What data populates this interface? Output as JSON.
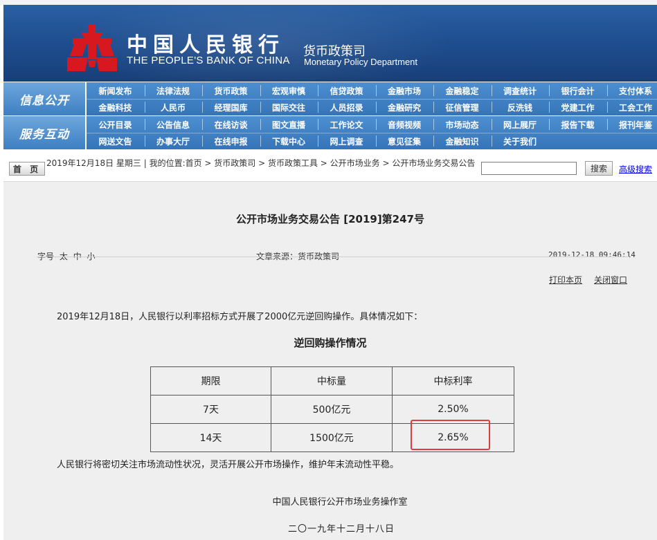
{
  "header": {
    "bank_name_cn": "中国人民银行",
    "bank_name_en": "THE PEOPLE'S BANK OF CHINA",
    "department_cn": "货币政策司",
    "department_en": "Monetary Policy Department",
    "brand_color": "#1f4f91",
    "emblem_color": "#d7191f"
  },
  "nav": {
    "groups": [
      {
        "title": "信息公开",
        "row1": [
          "新闻发布",
          "法律法规",
          "货币政策",
          "宏观审慎",
          "信贷政策",
          "金融市场",
          "金融稳定",
          "调查统计",
          "银行会计",
          "支付体系"
        ],
        "row2": [
          "金融科技",
          "人民币",
          "经理国库",
          "国际交往",
          "人员招录",
          "金融研究",
          "征信管理",
          "反洗钱",
          "党建工作",
          "工会工作"
        ]
      },
      {
        "title": "服务互动",
        "row1": [
          "公开目录",
          "公告信息",
          "在线访谈",
          "图文直播",
          "工作论文",
          "音频视频",
          "市场动态",
          "网上展厅",
          "报告下载",
          "报刊年鉴"
        ],
        "row2": [
          "网送文告",
          "办事大厅",
          "在线申报",
          "下载中心",
          "网上调查",
          "意见征集",
          "金融知识",
          "关于我们"
        ]
      }
    ]
  },
  "breadcrumb": {
    "home_label": "首 页",
    "text": "2019年12月18日 星期三 | 我的位置:首页 > 货币政策司 > 货币政策工具 > 公开市场业务 > 公开市场业务交易公告",
    "search_placeholder": "",
    "search_button": "搜索",
    "advanced_search": "高级搜索"
  },
  "article": {
    "title": "公开市场业务交易公告 [2019]第247号",
    "font_size_label": "字号",
    "font_sizes": [
      "太",
      "中",
      "小"
    ],
    "source": "文章来源：货币政策司",
    "datetime": "2019-12-18 09:46:14",
    "print_link": "打印本页",
    "close_link": "关闭窗口",
    "paragraph1": "2019年12月18日，人民银行以利率招标方式开展了2000亿元逆回购操作。具体情况如下：",
    "table_title": "逆回购操作情况",
    "table": {
      "headers": [
        "期限",
        "中标量",
        "中标利率"
      ],
      "rows": [
        [
          "7天",
          "500亿元",
          "2.50%"
        ],
        [
          "14天",
          "1500亿元",
          "2.65%"
        ]
      ],
      "highlight_color": "#e23b3b"
    },
    "paragraph2": "人民银行将密切关注市场流动性状况，灵活开展公开市场操作，维护年末流动性平稳。",
    "signature_org": "中国人民银行公开市场业务操作室",
    "signature_date": "二〇一九年十二月十八日"
  }
}
